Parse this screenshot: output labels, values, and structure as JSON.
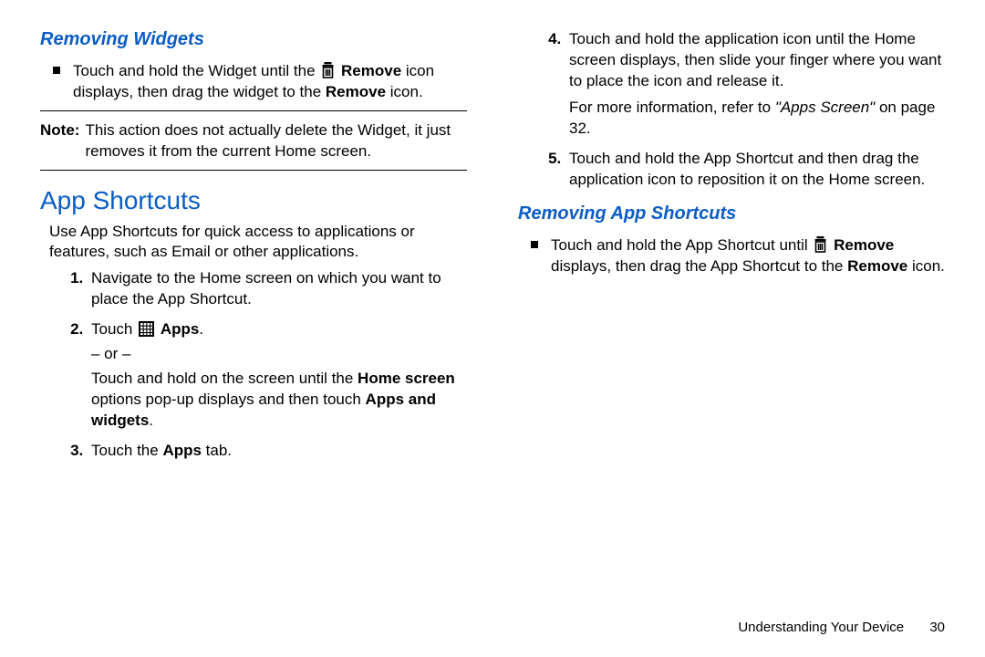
{
  "left": {
    "removingWidgets": {
      "title": "Removing Widgets",
      "bullet_a": "Touch and hold the Widget until the ",
      "bullet_remove": "Remove",
      "bullet_b": " icon displays, then drag the widget to the ",
      "bullet_remove2": "Remove",
      "bullet_c": " icon.",
      "noteLabel": "Note:",
      "noteBody": "This action does not actually delete the Widget, it just removes it from the current Home screen."
    },
    "appShortcuts": {
      "title": "App Shortcuts",
      "intro": "Use App Shortcuts for quick access to applications or features, such as Email or other applications.",
      "step1": "Navigate to the Home screen on which you want to place the App Shortcut.",
      "step2_a": "Touch ",
      "step2_apps": "Apps",
      "step2_dot": ".",
      "step2_or": "– or –",
      "step2_b1": "Touch and hold on the screen until the ",
      "step2_home": "Home screen",
      "step2_b2": " options pop-up displays and then touch ",
      "step2_aw": "Apps and widgets",
      "step2_b3": ".",
      "step3_a": "Touch the ",
      "step3_apps": "Apps",
      "step3_b": " tab."
    }
  },
  "right": {
    "step4_a": "Touch and hold the application icon until the Home screen displays, then slide your finger where you want to place the icon and release it.",
    "step4_more1": "For more information, refer to ",
    "step4_ref": "\"Apps Screen\"",
    "step4_more2": " on page 32.",
    "step5": "Touch and hold the App Shortcut and then drag the application icon to reposition it on the Home screen.",
    "removingAppShortcuts": {
      "title": "Removing App Shortcuts",
      "bullet_a": "Touch and hold the App Shortcut until ",
      "bullet_remove": "Remove",
      "bullet_b": " displays, then drag the App Shortcut to the ",
      "bullet_remove2": "Remove",
      "bullet_c": " icon."
    }
  },
  "footer": {
    "chapter": "Understanding Your Device",
    "page": "30"
  }
}
